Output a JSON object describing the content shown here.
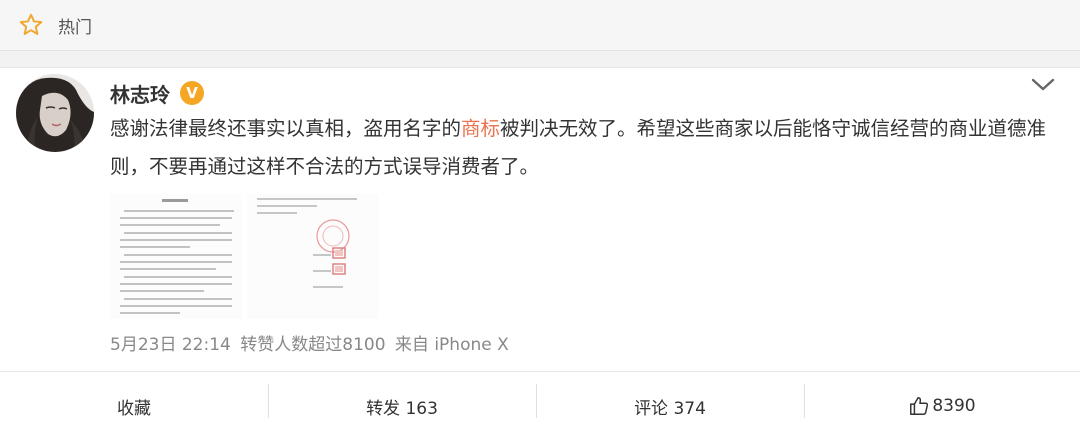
{
  "header": {
    "title": "热门"
  },
  "post": {
    "author": "林志玲",
    "badge": "V",
    "text_part1": "感谢法律最终还事实以真相，盗用名字的",
    "text_highlight": "商标",
    "text_part2": "被判决无效了。希望这些商家以后能恪守诚信经营的商业道德准则，不要再通过这样不合法的方式误导消费者了。",
    "time": "5月23日 22:14",
    "repost_info": "转赞人数超过8100",
    "source": "来自 iPhone X"
  },
  "actions": {
    "favorite": "收藏",
    "repost": "转发 163",
    "comment": "评论 374",
    "like_count": "8390"
  },
  "colors": {
    "highlight": "#eb7350",
    "badge": "#f5a623",
    "meta": "#888888"
  },
  "icons": {
    "header": "star-icon",
    "menu": "chevron-down-icon",
    "like": "thumbs-up-icon"
  }
}
